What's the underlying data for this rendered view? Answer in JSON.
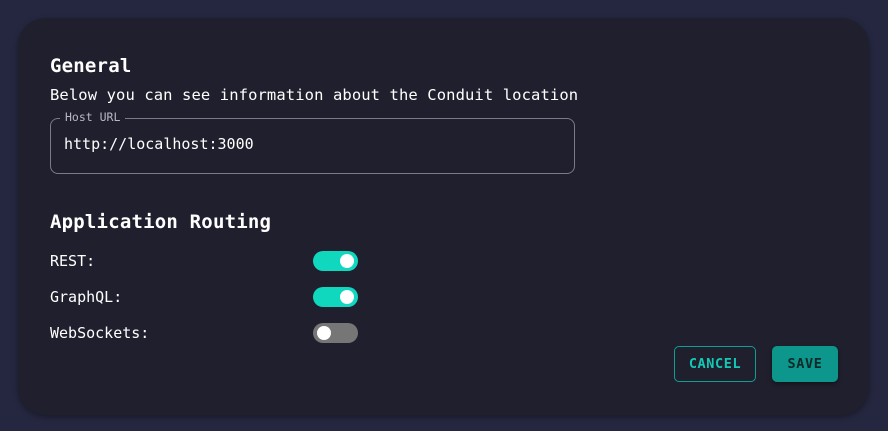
{
  "general": {
    "title": "General",
    "description": "Below you can see information about the Conduit location",
    "host_url": {
      "label": "Host URL",
      "value": "http://localhost:3000"
    }
  },
  "routing": {
    "title": "Application Routing",
    "items": [
      {
        "label": "REST:",
        "enabled": true
      },
      {
        "label": "GraphQL:",
        "enabled": true
      },
      {
        "label": "WebSockets:",
        "enabled": false
      }
    ]
  },
  "actions": {
    "cancel_label": "CANCEL",
    "save_label": "SAVE"
  },
  "colors": {
    "accent": "#10d8bf",
    "background": "#252740",
    "card": "#201f2d",
    "switch_off": "#767676"
  }
}
